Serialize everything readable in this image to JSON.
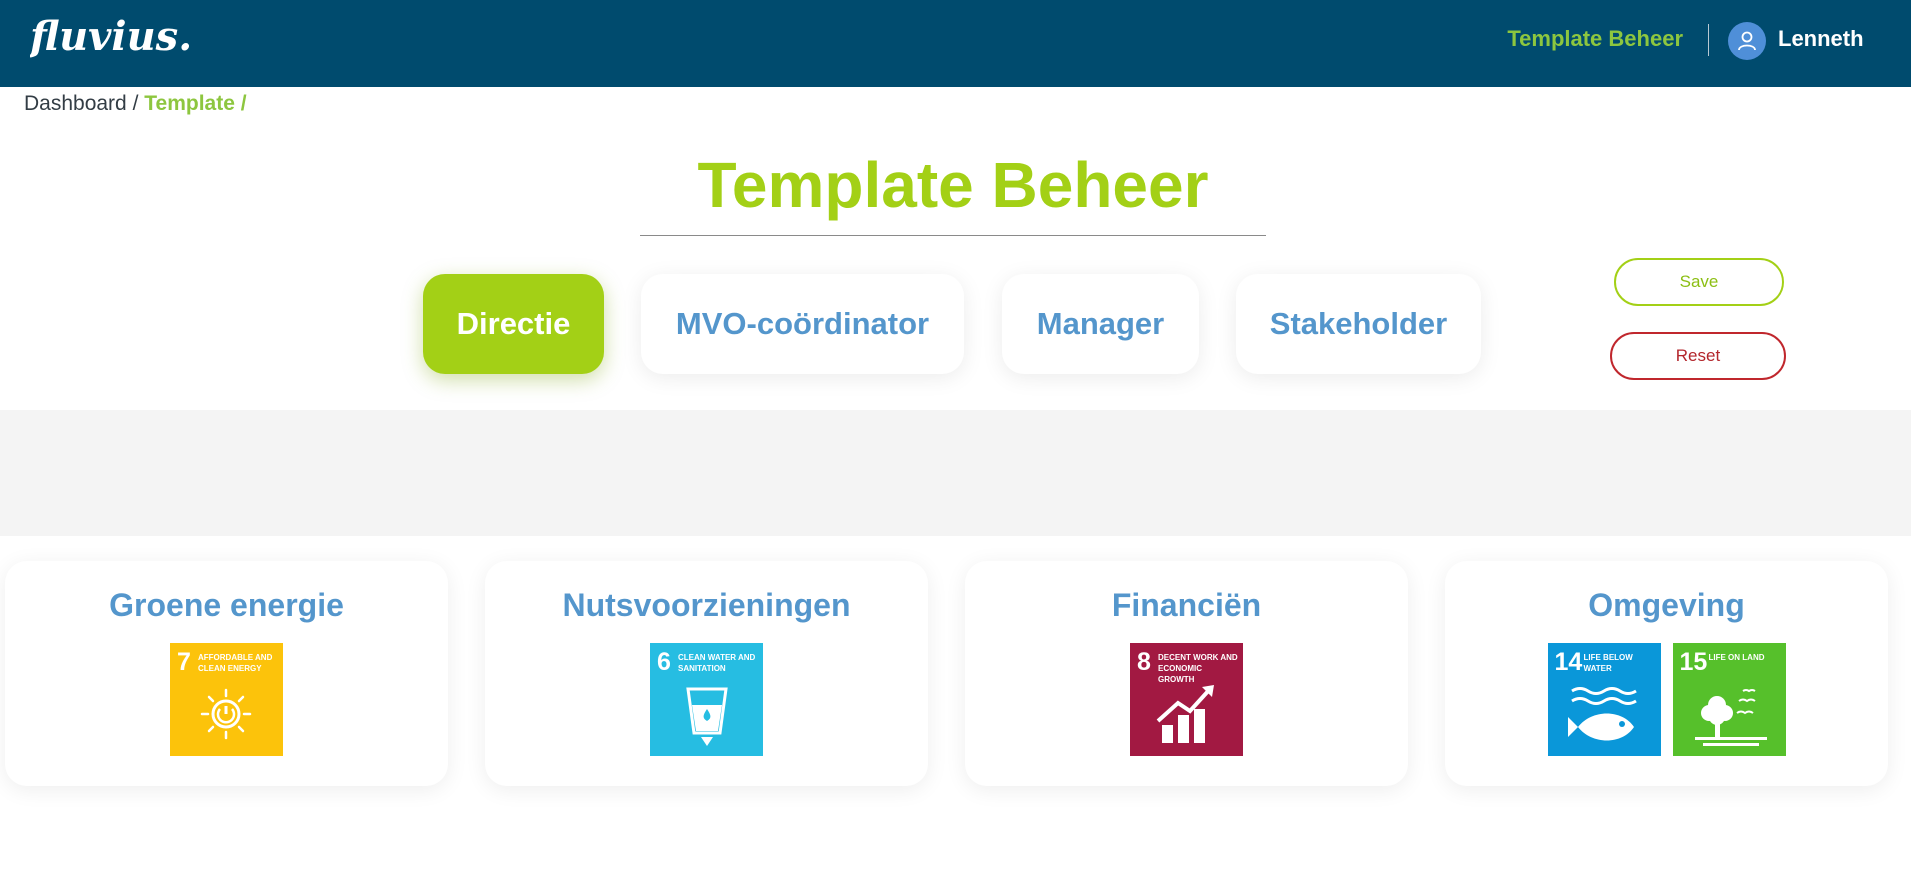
{
  "header": {
    "logo_text": "fluvius.",
    "nav_link": "Template Beheer",
    "user_name": "Lenneth"
  },
  "breadcrumb": {
    "items": [
      "Dashboard",
      "Template"
    ],
    "separator": "/"
  },
  "page": {
    "title": "Template Beheer"
  },
  "tabs": [
    {
      "label": "Directie",
      "active": true
    },
    {
      "label": "MVO-coördinator",
      "active": false
    },
    {
      "label": "Manager",
      "active": false
    },
    {
      "label": "Stakeholder",
      "active": false
    }
  ],
  "actions": {
    "save_label": "Save",
    "reset_label": "Reset"
  },
  "cards": [
    {
      "title": "Groene energie",
      "sdgs": [
        {
          "number": "7",
          "label": "Affordable and clean energy",
          "color": "#fcc30b",
          "icon": "sun-power-icon"
        }
      ]
    },
    {
      "title": "Nutsvoorzieningen",
      "sdgs": [
        {
          "number": "6",
          "label": "Clean water and sanitation",
          "color": "#26bde2",
          "icon": "water-glass-icon"
        }
      ]
    },
    {
      "title": "Financiën",
      "sdgs": [
        {
          "number": "8",
          "label": "Decent work and economic growth",
          "color": "#a21942",
          "icon": "growth-chart-icon"
        }
      ]
    },
    {
      "title": "Omgeving",
      "sdgs": [
        {
          "number": "14",
          "label": "Life below water",
          "color": "#0a97d9",
          "icon": "fish-icon"
        },
        {
          "number": "15",
          "label": "Life on land",
          "color": "#56c02b",
          "icon": "tree-icon"
        }
      ]
    }
  ],
  "colors": {
    "header_bg": "#004b6e",
    "accent_green": "#a3d016",
    "link_blue": "#5496cc",
    "reset_red": "#c0272d"
  }
}
